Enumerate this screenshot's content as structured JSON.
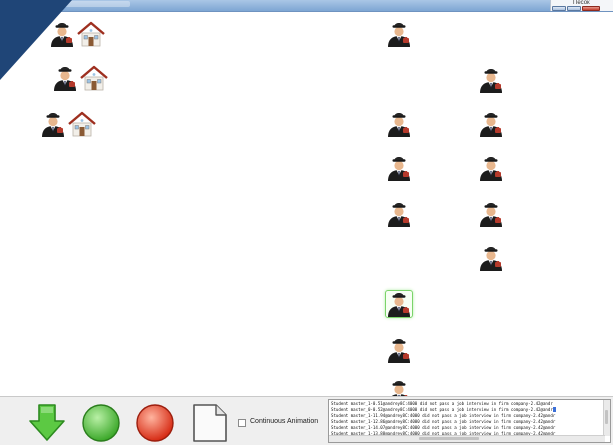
{
  "window": {
    "external_label": "Песок"
  },
  "icons": {
    "agent": "student-agent-icon",
    "company": "company-house-icon",
    "down": "green-down-arrow-icon",
    "go": "green-circle-icon",
    "stop": "red-circle-icon",
    "new": "blank-document-icon"
  },
  "colors": {
    "titlebar": "#8fb3dd",
    "corner": "#1f4577",
    "selection": "#7bd46a",
    "go_green": "#4fc23a",
    "stop_red": "#e03a22"
  },
  "toolbar": {
    "continuous_animation_label": "Continuous Animation",
    "continuous_animation_checked": false
  },
  "console": {
    "lines": [
      "Student master_1-0.51@andrey8C:4000 did not pass a job interview in firm company-2.42@andr",
      "Student master_0-0.52@andrey8C:4000 did not pass a job interview in firm company-2.42@andr",
      "Student master_1-11.94@andrey8C:4000 did not pass a job interview in firm company-2.42@andr",
      "Student master_1-12.86@andrey8C:4000 did not pass a job interview in firm company-2.42@andr",
      "Student master_1-14.07@andrey8C:4000 did not pass a job interview in firm company-2.42@andr",
      "Student master_1-13.88@andrey8C:4000 did not pass a job interview in firm company-2.42@andr"
    ]
  }
}
